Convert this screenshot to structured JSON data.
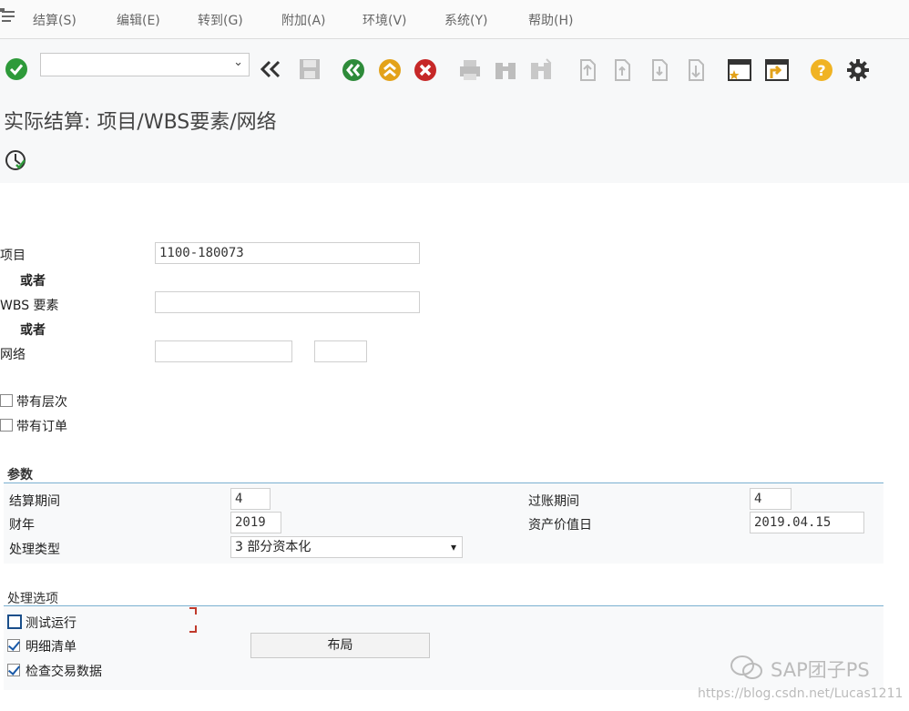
{
  "menu": {
    "items": [
      "结算(S)",
      "编辑(E)",
      "转到(G)",
      "附加(A)",
      "环境(V)",
      "系统(Y)",
      "帮助(H)"
    ]
  },
  "toolbar": {
    "command_value": "",
    "icons": [
      "enter-icon",
      "dropdown-icon",
      "back-double-icon",
      "save-icon",
      "back-icon",
      "exit-icon",
      "cancel-icon",
      "print-icon",
      "find-icon",
      "find-next-icon",
      "first-page-icon",
      "prev-page-icon",
      "next-page-icon",
      "last-page-icon",
      "new-session-icon",
      "shortcut-icon",
      "help-icon",
      "settings-icon"
    ]
  },
  "page": {
    "title": "实际结算: 项目/WBS要素/网络"
  },
  "selection": {
    "project_label": "项目",
    "project_value": "1100-180073",
    "or1": "或者",
    "wbs_label": "WBS 要素",
    "wbs_value": "",
    "or2": "或者",
    "network_label": "网络",
    "network_value": "",
    "network_value2": "",
    "with_hierarchy_label": "带有层次",
    "with_orders_label": "带有订单",
    "with_hierarchy": false,
    "with_orders": false
  },
  "params": {
    "section_title": "参数",
    "settlement_period_label": "结算期间",
    "settlement_period_value": "4",
    "posting_period_label": "过账期间",
    "posting_period_value": "4",
    "fiscal_year_label": "财年",
    "fiscal_year_value": "2019",
    "asset_value_date_label": "资产价值日",
    "asset_value_date_value": "2019.04.15",
    "processing_type_label": "处理类型",
    "processing_type_value": "3 部分资本化"
  },
  "options": {
    "section_title": "处理选项",
    "test_run_label": "测试运行",
    "detail_list_label": "明细清单",
    "check_trans_label": "检查交易数据",
    "test_run": false,
    "detail_list": true,
    "check_trans": true,
    "layout_button": "布局"
  },
  "watermark": {
    "brand": "SAP团子PS",
    "url": "https://blog.csdn.net/Lucas1211"
  },
  "colors": {
    "accent_line": "#7ab0d0",
    "enter_green": "#2e9a3a",
    "back_green": "#2e8b3a",
    "exit_yellow": "#e3a21a",
    "cancel_red": "#c62828",
    "help_yellow": "#f0b323"
  }
}
